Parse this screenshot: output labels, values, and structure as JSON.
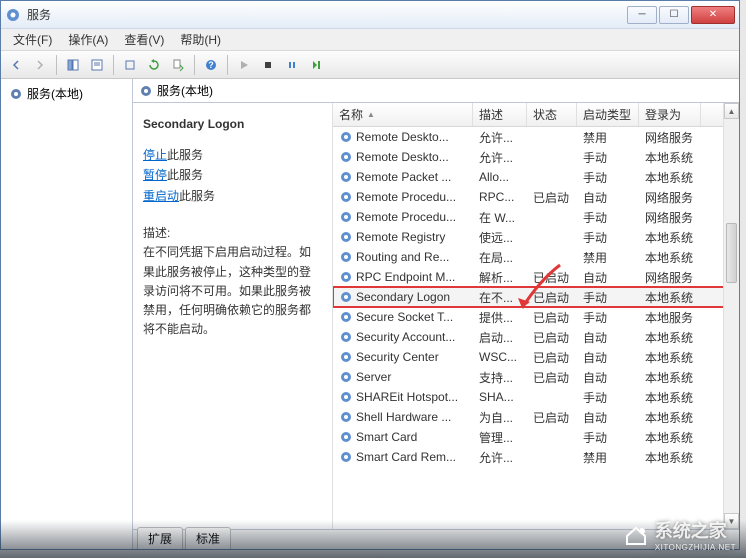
{
  "title": "服务",
  "menu": {
    "file": "文件(F)",
    "action": "操作(A)",
    "view": "查看(V)",
    "help": "帮助(H)"
  },
  "left": {
    "root": "服务(本地)"
  },
  "rightheader": "服务(本地)",
  "detail": {
    "title": "Secondary Logon",
    "link_stop": "停止",
    "link_stop_suffix": "此服务",
    "link_pause": "暂停",
    "link_pause_suffix": "此服务",
    "link_restart": "重启动",
    "link_restart_suffix": "此服务",
    "desc_label": "描述:",
    "desc_text": "在不同凭据下启用启动过程。如果此服务被停止，这种类型的登录访问将不可用。如果此服务被禁用，任何明确依赖它的服务都将不能启动。"
  },
  "columns": {
    "name": "名称",
    "desc": "描述",
    "status": "状态",
    "start": "启动类型",
    "logon": "登录为"
  },
  "services": [
    {
      "name": "Remote Deskto...",
      "desc": "允许...",
      "status": "",
      "start": "禁用",
      "logon": "网络服务"
    },
    {
      "name": "Remote Deskto...",
      "desc": "允许...",
      "status": "",
      "start": "手动",
      "logon": "本地系统"
    },
    {
      "name": "Remote Packet ...",
      "desc": "Allo...",
      "status": "",
      "start": "手动",
      "logon": "本地系统"
    },
    {
      "name": "Remote Procedu...",
      "desc": "RPC...",
      "status": "已启动",
      "start": "自动",
      "logon": "网络服务"
    },
    {
      "name": "Remote Procedu...",
      "desc": "在 W...",
      "status": "",
      "start": "手动",
      "logon": "网络服务"
    },
    {
      "name": "Remote Registry",
      "desc": "使远...",
      "status": "",
      "start": "手动",
      "logon": "本地系统"
    },
    {
      "name": "Routing and Re...",
      "desc": "在局...",
      "status": "",
      "start": "禁用",
      "logon": "本地系统"
    },
    {
      "name": "RPC Endpoint M...",
      "desc": "解析...",
      "status": "已启动",
      "start": "自动",
      "logon": "网络服务"
    },
    {
      "name": "Secondary Logon",
      "desc": "在不...",
      "status": "已启动",
      "start": "手动",
      "logon": "本地系统",
      "highlight": true
    },
    {
      "name": "Secure Socket T...",
      "desc": "提供...",
      "status": "已启动",
      "start": "手动",
      "logon": "本地服务"
    },
    {
      "name": "Security Account...",
      "desc": "启动...",
      "status": "已启动",
      "start": "自动",
      "logon": "本地系统"
    },
    {
      "name": "Security Center",
      "desc": "WSC...",
      "status": "已启动",
      "start": "自动",
      "logon": "本地系统"
    },
    {
      "name": "Server",
      "desc": "支持...",
      "status": "已启动",
      "start": "自动",
      "logon": "本地系统"
    },
    {
      "name": "SHAREit Hotspot...",
      "desc": "SHA...",
      "status": "",
      "start": "手动",
      "logon": "本地系统"
    },
    {
      "name": "Shell Hardware ...",
      "desc": "为自...",
      "status": "已启动",
      "start": "自动",
      "logon": "本地系统"
    },
    {
      "name": "Smart Card",
      "desc": "管理...",
      "status": "",
      "start": "手动",
      "logon": "本地系统"
    },
    {
      "name": "Smart Card Rem...",
      "desc": "允许...",
      "status": "",
      "start": "禁用",
      "logon": "本地系统"
    }
  ],
  "tabs": {
    "ext": "扩展",
    "std": "标准"
  },
  "watermark": "系统之家",
  "watermark_url": "XITONGZHIJIA.NET"
}
